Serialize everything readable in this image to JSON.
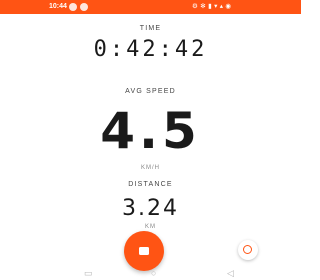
{
  "colors": {
    "accent": "#FF5414"
  },
  "status_bar": {
    "time": "10:44",
    "right_text": "⚙ ✻ ▮ ▾ ▴ ◉"
  },
  "time": {
    "label": "TIME",
    "value": "0:42:42"
  },
  "speed": {
    "label": "AVG SPEED",
    "value": "4.5",
    "unit": "KM/H"
  },
  "distance": {
    "label": "DISTANCE",
    "value": "3.24",
    "unit": "KM"
  },
  "controls": {
    "stop_icon": "stop-icon",
    "location_icon": "location-icon"
  },
  "nav": {
    "back": "◁",
    "home": "○",
    "recents": "▭"
  }
}
